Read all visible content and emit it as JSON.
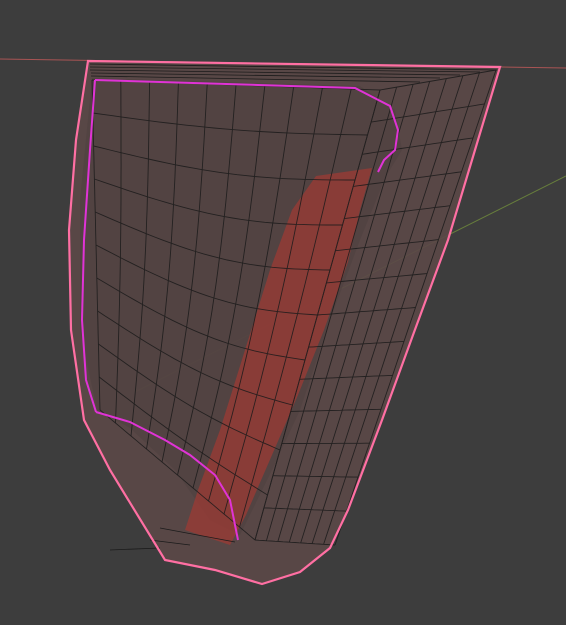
{
  "viewport": {
    "background": "#3d3d3d",
    "axis_x_color": "#c45a5a",
    "axis_y_color": "#6f8a3c",
    "selection_outline_color": "#ff6fa3",
    "selection_inner_color": "#e033d6",
    "wire_color": "#1a1a1a",
    "mesh_fill": "#5b4847",
    "inner_fill": "#8f3a35"
  },
  "objects": [
    {
      "name": "selected-mesh",
      "state": "selected"
    }
  ]
}
